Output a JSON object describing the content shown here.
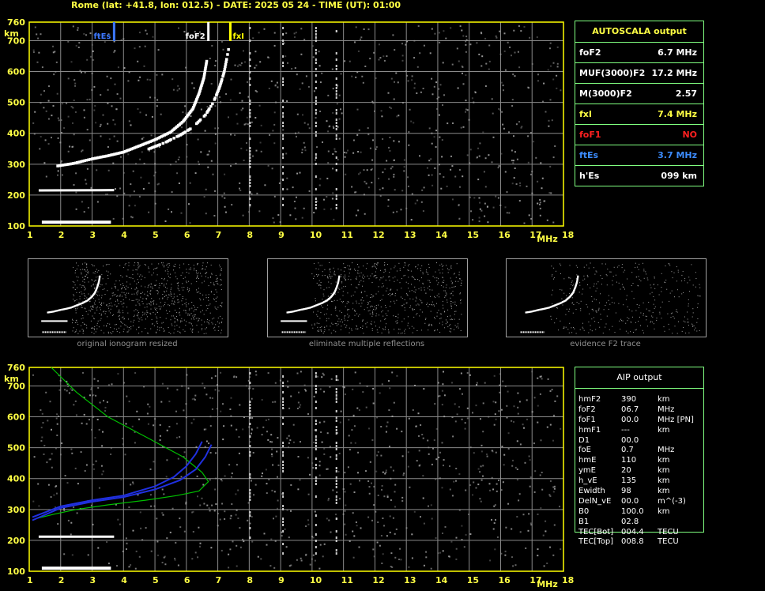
{
  "header": "Rome (lat: +41.8, lon: 012.5) - DATE: 2025 05 24 - TIME (UT): 01:00",
  "colors": {
    "grid": "#8a8a8a",
    "frame": "#ffff00",
    "fof2_marker": "#ffffff",
    "fxi_marker": "#ffff00",
    "ftes_marker": "#3c78ff",
    "profile": "#00c000",
    "fit": "#2030e0",
    "noise": "#a0a0a0"
  },
  "chart_data": [
    {
      "type": "scatter",
      "title": "",
      "xlabel": "MHz",
      "ylabel": "km",
      "xlim": [
        1,
        18
      ],
      "ylim": [
        100,
        760
      ],
      "x_ticks": [
        "1",
        "2",
        "3",
        "4",
        "5",
        "6",
        "7",
        "8",
        "9",
        "10",
        "11",
        "12",
        "13",
        "14",
        "15",
        "16",
        "17",
        "18"
      ],
      "y_ticks": [
        "100",
        "200",
        "300",
        "400",
        "500",
        "600",
        "700",
        "760"
      ],
      "grid": true,
      "markers": [
        {
          "label": "ftEs",
          "x": 3.7,
          "color": "#3c78ff"
        },
        {
          "label": "foF2",
          "x": 6.7,
          "color": "#ffffff"
        },
        {
          "label": "fxI",
          "x": 7.4,
          "color": "#ffff00"
        }
      ],
      "series": [
        {
          "trace": "o-mode F2",
          "points": [
            [
              1.9,
              295
            ],
            [
              2.4,
              303
            ],
            [
              3.0,
              318
            ],
            [
              3.5,
              328
            ],
            [
              4.0,
              340
            ],
            [
              4.5,
              360
            ],
            [
              5.0,
              380
            ],
            [
              5.5,
              405
            ],
            [
              5.9,
              440
            ],
            [
              6.2,
              480
            ],
            [
              6.4,
              530
            ],
            [
              6.55,
              580
            ],
            [
              6.65,
              640
            ]
          ]
        },
        {
          "trace": "x-mode F2",
          "points": [
            [
              4.8,
              350
            ],
            [
              5.3,
              370
            ],
            [
              5.8,
              395
            ],
            [
              6.2,
              420
            ],
            [
              6.6,
              460
            ],
            [
              6.85,
              500
            ],
            [
              7.05,
              550
            ],
            [
              7.2,
              600
            ],
            [
              7.35,
              680
            ]
          ]
        },
        {
          "trace": "Es",
          "points": [
            [
              1.3,
              215
            ],
            [
              2.0,
              218
            ],
            [
              2.6,
              220
            ],
            [
              3.2,
              218
            ],
            [
              3.7,
              216
            ]
          ]
        },
        {
          "trace": "ground echo",
          "points": [
            [
              1.4,
              112
            ],
            [
              3.6,
              112
            ]
          ]
        }
      ]
    },
    {
      "type": "line",
      "title": "",
      "xlabel": "MHz",
      "ylabel": "km",
      "xlim": [
        1,
        18
      ],
      "ylim": [
        100,
        760
      ],
      "x_ticks": [
        "1",
        "2",
        "3",
        "4",
        "5",
        "6",
        "7",
        "8",
        "9",
        "10",
        "11",
        "12",
        "13",
        "14",
        "15",
        "16",
        "17",
        "18"
      ],
      "y_ticks": [
        "100",
        "200",
        "300",
        "400",
        "500",
        "600",
        "700",
        "760"
      ],
      "grid": true,
      "series": [
        {
          "trace": "electron density profile",
          "points": [
            [
              1.7,
              760
            ],
            [
              2.5,
              680
            ],
            [
              3.5,
              600
            ],
            [
              4.8,
              530
            ],
            [
              5.9,
              470
            ],
            [
              6.5,
              420
            ],
            [
              6.7,
              390
            ],
            [
              6.4,
              360
            ],
            [
              5.7,
              345
            ],
            [
              4.7,
              330
            ],
            [
              3.5,
              315
            ],
            [
              2.5,
              300
            ],
            [
              1.8,
              285
            ],
            [
              1.2,
              270
            ]
          ]
        },
        {
          "trace": "fitted trace",
          "points": [
            [
              1.1,
              275
            ],
            [
              2.0,
              310
            ],
            [
              3.0,
              330
            ],
            [
              4.0,
              345
            ],
            [
              5.0,
              375
            ],
            [
              5.6,
              405
            ],
            [
              6.0,
              440
            ],
            [
              6.3,
              480
            ],
            [
              6.5,
              520
            ]
          ]
        },
        {
          "trace": "fitted trace x",
          "points": [
            [
              1.1,
              265
            ],
            [
              2.0,
              305
            ],
            [
              3.0,
              325
            ],
            [
              4.0,
              340
            ],
            [
              5.0,
              365
            ],
            [
              5.8,
              395
            ],
            [
              6.3,
              430
            ],
            [
              6.6,
              470
            ],
            [
              6.8,
              510
            ]
          ]
        },
        {
          "trace": "Es",
          "points": [
            [
              1.3,
              212
            ],
            [
              3.7,
              212
            ]
          ]
        },
        {
          "trace": "ground echo",
          "points": [
            [
              1.4,
              110
            ],
            [
              3.6,
              110
            ]
          ]
        }
      ]
    }
  ],
  "thumbnails": [
    {
      "caption": "original ionogram resized"
    },
    {
      "caption": "eliminate multiple reflections"
    },
    {
      "caption": "evidence F2 trace"
    }
  ],
  "autoscala": {
    "title": "AUTOSCALA output",
    "rows": [
      {
        "name": "foF2",
        "value": "6.7 MHz",
        "color": "#ffffff"
      },
      {
        "name": "MUF(3000)F2",
        "value": "17.2 MHz",
        "color": "#ffffff"
      },
      {
        "name": "M(3000)F2",
        "value": "2.57",
        "color": "#ffffff"
      },
      {
        "name": "fxI",
        "value": "7.4 MHz",
        "color": "#ffff44"
      },
      {
        "name": "foF1",
        "value": "NO",
        "color": "#ff2020"
      },
      {
        "name": "ftEs",
        "value": "3.7 MHz",
        "color": "#3c8cff"
      },
      {
        "name": "h'Es",
        "value": "099    km",
        "color": "#ffffff"
      }
    ]
  },
  "aip": {
    "title": "AIP output",
    "rows": [
      {
        "name": "hmF2",
        "value": "390",
        "unit": "km"
      },
      {
        "name": "foF2",
        "value": "06.7",
        "unit": "MHz"
      },
      {
        "name": "foF1",
        "value": "00.0",
        "unit": "MHz   [PN]"
      },
      {
        "name": "hmF1",
        "value": "---",
        "unit": "km"
      },
      {
        "name": "D1",
        "value": "00.0",
        "unit": ""
      },
      {
        "name": "foE",
        "value": "0.7",
        "unit": "MHz"
      },
      {
        "name": "hmE",
        "value": "110",
        "unit": "km"
      },
      {
        "name": "ymE",
        "value": "20",
        "unit": "km"
      },
      {
        "name": "h_vE",
        "value": "135",
        "unit": "km"
      },
      {
        "name": "Ewidth",
        "value": "98",
        "unit": "km"
      },
      {
        "name": "DelN_vE",
        "value": "00.0",
        "unit": "m^(-3)"
      },
      {
        "name": "B0",
        "value": "100.0",
        "unit": "km"
      },
      {
        "name": "B1",
        "value": "02.8",
        "unit": ""
      },
      {
        "name": "TEC[Bot]",
        "value": "004.4",
        "unit": "TECU"
      },
      {
        "name": "TEC[Top]",
        "value": "008.8",
        "unit": "TECU"
      }
    ]
  }
}
